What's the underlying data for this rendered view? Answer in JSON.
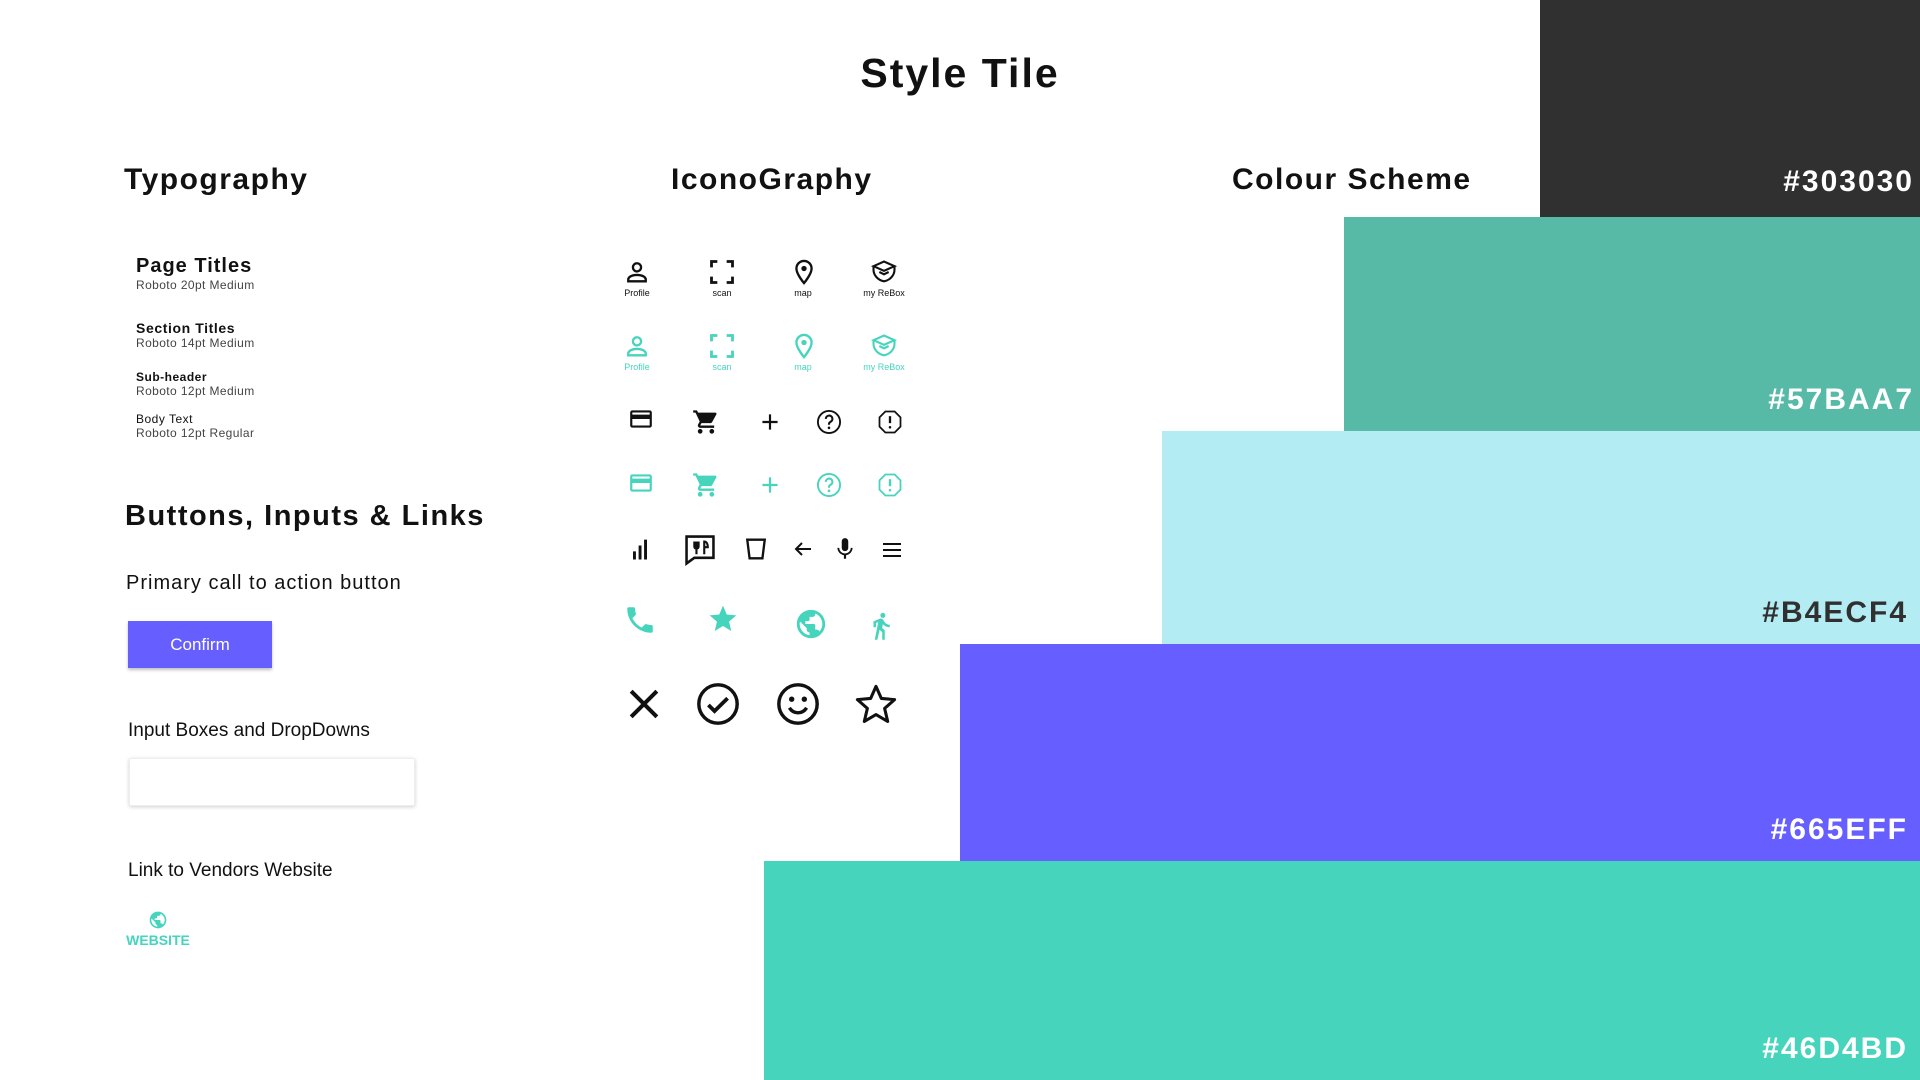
{
  "page": {
    "title": "Style Tile"
  },
  "typography": {
    "heading": "Typography",
    "samples": [
      {
        "name": "Page Titles",
        "spec": "Roboto 20pt Medium"
      },
      {
        "name": "Section Titles",
        "spec": "Roboto 14pt Medium"
      },
      {
        "name": "Sub-header",
        "spec": "Roboto 12pt Medium"
      },
      {
        "name": "Body Text",
        "spec": "Roboto 12pt Regular"
      }
    ]
  },
  "buttons": {
    "heading": "Buttons, Inputs & Links",
    "primary_label": "Primary call to action button",
    "confirm_label": "Confirm",
    "input_label": "Input Boxes and DropDowns",
    "input_value": "",
    "link_label": "Link to Vendors Website",
    "website_label": "WEBSITE"
  },
  "iconography": {
    "heading": "IconoGraphy",
    "nav_labels": [
      "Profile",
      "scan",
      "map",
      "my ReBox"
    ],
    "icons": [
      "person-icon",
      "scan-icon",
      "map-pin-icon",
      "box-icon",
      "credit-card-icon",
      "cart-icon",
      "plus-icon",
      "help-icon",
      "alert-icon",
      "bar-chart-icon",
      "restaurant-menu-icon",
      "cup-icon",
      "arrow-left-icon",
      "mic-icon",
      "menu-icon",
      "phone-icon",
      "star-filled-icon",
      "globe-icon",
      "walk-icon",
      "close-icon",
      "check-circle-icon",
      "smiley-icon",
      "star-outline-icon"
    ]
  },
  "colours": {
    "heading": "Colour Scheme",
    "swatches": [
      {
        "hex": "#303030",
        "label": "#303030"
      },
      {
        "hex": "#57BAA7",
        "label": "#57BAA7"
      },
      {
        "hex": "#B4ECF4",
        "label": "#B4ECF4"
      },
      {
        "hex": "#665EFF",
        "label": "#665EFF"
      },
      {
        "hex": "#46D4BD",
        "label": "#46D4BD"
      }
    ]
  }
}
